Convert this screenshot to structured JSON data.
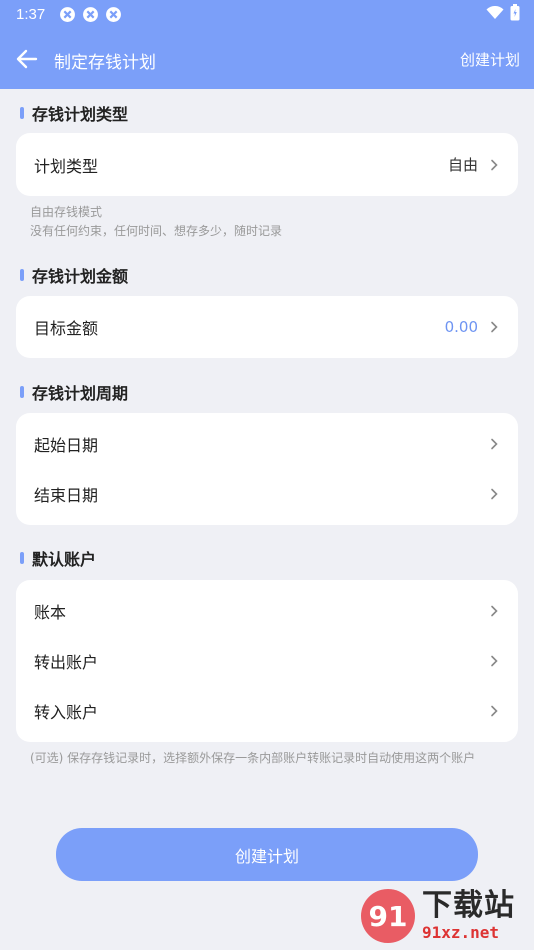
{
  "status_bar": {
    "time": "1:37"
  },
  "nav": {
    "title": "制定存钱计划",
    "action": "创建计划"
  },
  "sections": {
    "type": {
      "title": "存钱计划类型",
      "rows": [
        {
          "label": "计划类型",
          "value": "自由"
        }
      ],
      "hint_line1": "自由存钱模式",
      "hint_line2": "没有任何约束，任何时间、想存多少，随时记录"
    },
    "amount": {
      "title": "存钱计划金额",
      "rows": [
        {
          "label": "目标金额",
          "value": "0.00"
        }
      ]
    },
    "period": {
      "title": "存钱计划周期",
      "rows": [
        {
          "label": "起始日期"
        },
        {
          "label": "结束日期"
        }
      ]
    },
    "account": {
      "title": "默认账户",
      "rows": [
        {
          "label": "账本"
        },
        {
          "label": "转出账户"
        },
        {
          "label": "转入账户"
        }
      ],
      "hint": "(可选) 保存存钱记录时，选择额外保存一条内部账户转账记录时自动使用这两个账户"
    }
  },
  "create_button": "创建计划",
  "watermark": {
    "logo_text": "91",
    "big": "下载站",
    "small": "91xz.net"
  },
  "colors": {
    "accent": "#7b9ff9",
    "amount_text": "#6e94f2",
    "background": "#eff0f5"
  }
}
